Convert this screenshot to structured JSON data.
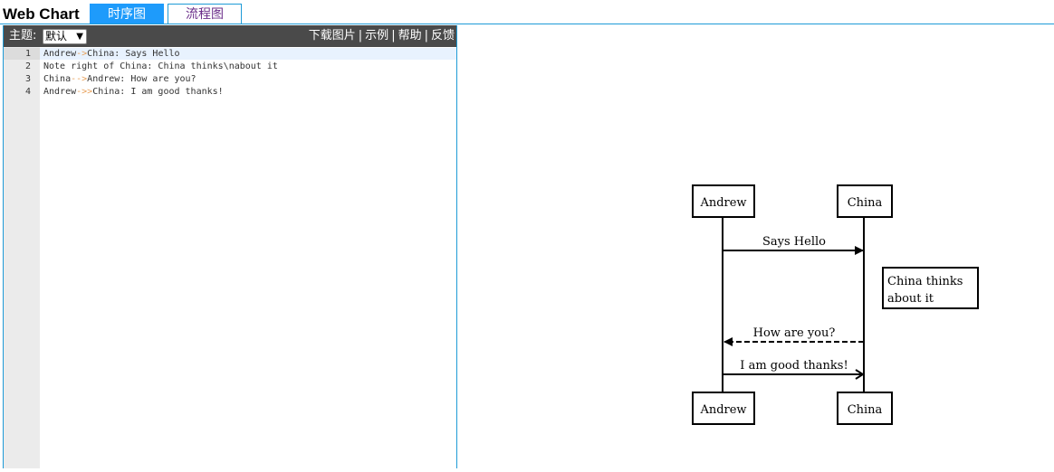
{
  "header": {
    "title": "Web Chart",
    "tabs": [
      {
        "label": "时序图",
        "active": true
      },
      {
        "label": "流程图",
        "active": false
      }
    ]
  },
  "toolbar": {
    "theme_label": "主题:",
    "theme_value": "默认",
    "links": [
      "下载图片",
      "示例",
      "帮助",
      "反馈"
    ]
  },
  "editor": {
    "lines": [
      {
        "num": "1",
        "text": "Andrew->China: Says Hello"
      },
      {
        "num": "2",
        "text": "Note right of China: China thinks\\nabout it"
      },
      {
        "num": "3",
        "text": "China-->Andrew: How are you?"
      },
      {
        "num": "4",
        "text": "Andrew->>China: I am good thanks!"
      }
    ]
  },
  "diagram": {
    "actors": [
      "Andrew",
      "China"
    ],
    "messages": [
      "Says Hello",
      "How are you?",
      "I am good thanks!"
    ],
    "note_lines": [
      "China thinks",
      "about it"
    ]
  },
  "colors": {
    "accent": "#1e9bfb",
    "toolbar_bg": "#4a4a4a",
    "gutter_bg": "#ebebeb",
    "arrow_token": "#e8a15a",
    "inactive_tab_text": "#6b2f8a"
  }
}
